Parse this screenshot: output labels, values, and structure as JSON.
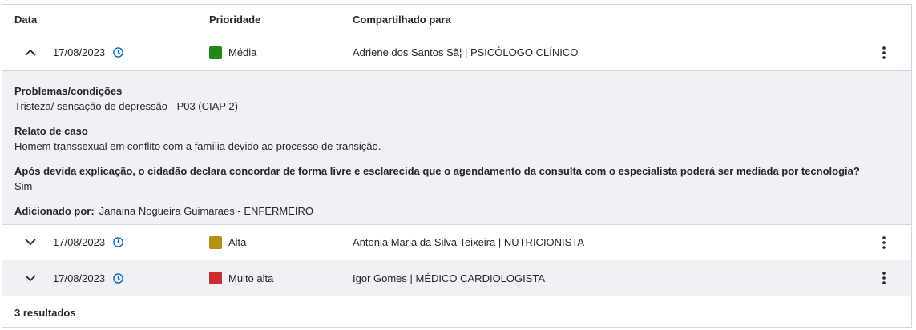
{
  "header": {
    "date": "Data",
    "priority": "Prioridade",
    "shared": "Compartilhado para"
  },
  "rows": [
    {
      "date": "17/08/2023",
      "priority": "Média",
      "priority_color": "#1e8a1a",
      "shared": "Adriene dos Santos Sã¦ | PSICÓLOGO CLÍNICO",
      "expanded": true,
      "chevron": "chevron-up-icon"
    },
    {
      "date": "17/08/2023",
      "priority": "Alta",
      "priority_color": "#b8900f",
      "shared": "Antonia Maria da Silva Teixeira | NUTRICIONISTA",
      "expanded": false,
      "chevron": "chevron-down-icon"
    },
    {
      "date": "17/08/2023",
      "priority": "Muito alta",
      "priority_color": "#d02b2b",
      "shared": "Igor Gomes | MÉDICO CARDIOLOGISTA",
      "expanded": false,
      "chevron": "chevron-down-icon"
    }
  ],
  "detail": {
    "problems_title": "Problemas/condições",
    "problems_text": "Tristeza/ sensação de depressão - P03 (CIAP 2)",
    "case_title": "Relato de caso",
    "case_text": "Homem transsexual em conflito com a família devido ao processo de transição.",
    "consent_title": "Após devida explicação, o cidadão declara concordar de forma livre e esclarecida que o agendamento da consulta com o especialista poderá ser mediada por tecnologia?",
    "consent_text": "Sim",
    "added_label": "Adicionado por:",
    "added_value": "Janaina Nogueira Guimaraes - ENFERMEIRO"
  },
  "footer": {
    "results": "3 resultados"
  },
  "colors": {
    "accent": "#0069d0",
    "border": "#d3d4dd",
    "expanded_bg": "#f0f0f5"
  }
}
